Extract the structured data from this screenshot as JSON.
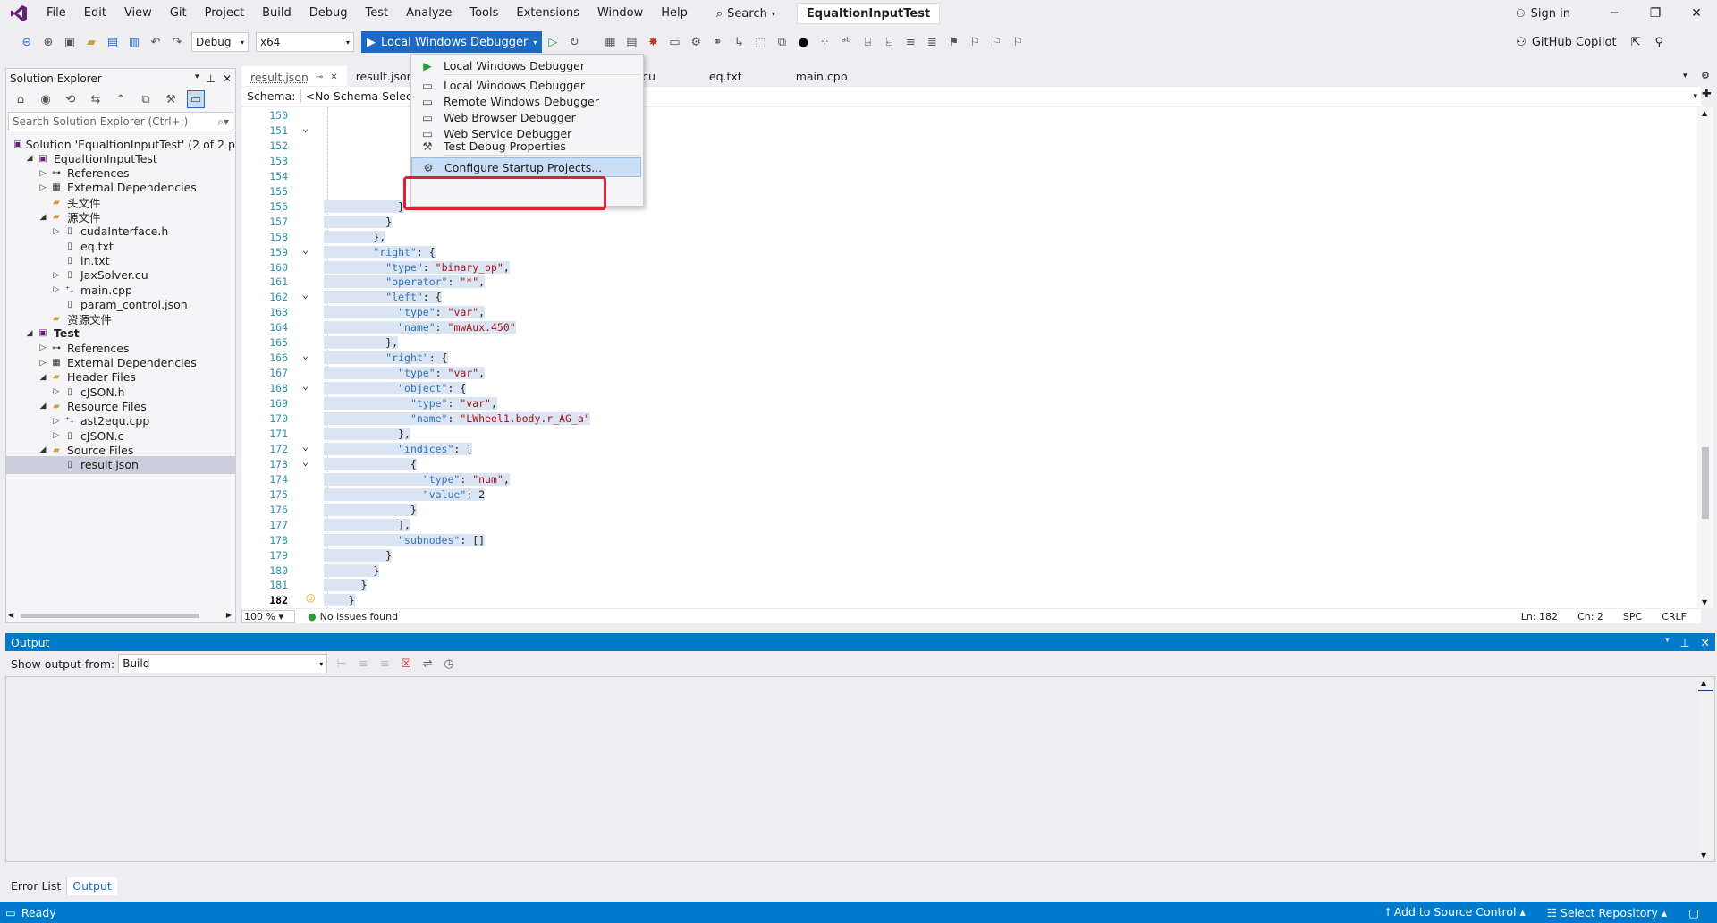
{
  "menu": {
    "items": [
      "File",
      "Edit",
      "View",
      "Git",
      "Project",
      "Build",
      "Debug",
      "Test",
      "Analyze",
      "Tools",
      "Extensions",
      "Window",
      "Help"
    ],
    "search": "Search",
    "title": "EqualtionInputTest",
    "sign_in": "Sign in"
  },
  "toolbar": {
    "config": "Debug",
    "platform": "x64",
    "debugger": "Local Windows Debugger",
    "copilot": "GitHub Copilot"
  },
  "solution_explorer": {
    "title": "Solution Explorer",
    "search_placeholder": "Search Solution Explorer (Ctrl+;)",
    "items": [
      {
        "label": "Solution 'EqualtionInputTest' (2 of 2 p",
        "indent": 0,
        "tw": "",
        "icon": "solution-icon"
      },
      {
        "label": "EqualtionInputTest",
        "indent": 1,
        "tw": "◢",
        "icon": "project-icon"
      },
      {
        "label": "References",
        "indent": 2,
        "tw": "▷",
        "icon": "references-icon"
      },
      {
        "label": "External Dependencies",
        "indent": 2,
        "tw": "▷",
        "icon": "dependencies-icon"
      },
      {
        "label": "头文件",
        "indent": 2,
        "tw": "",
        "icon": "folder-icon"
      },
      {
        "label": "源文件",
        "indent": 2,
        "tw": "◢",
        "icon": "folder-icon"
      },
      {
        "label": "cudaInterface.h",
        "indent": 3,
        "tw": "▷",
        "icon": "file-icon"
      },
      {
        "label": "eq.txt",
        "indent": 3,
        "tw": "",
        "icon": "file-icon"
      },
      {
        "label": "in.txt",
        "indent": 3,
        "tw": "",
        "icon": "file-icon"
      },
      {
        "label": "JaxSolver.cu",
        "indent": 3,
        "tw": "▷",
        "icon": "file-icon"
      },
      {
        "label": "main.cpp",
        "indent": 3,
        "tw": "▷",
        "icon": "cpp-file-icon"
      },
      {
        "label": "param_control.json",
        "indent": 3,
        "tw": "",
        "icon": "file-icon"
      },
      {
        "label": "资源文件",
        "indent": 2,
        "tw": "",
        "icon": "folder-icon"
      },
      {
        "label": "Test",
        "indent": 1,
        "tw": "◢",
        "icon": "project-icon",
        "bold": true
      },
      {
        "label": "References",
        "indent": 2,
        "tw": "▷",
        "icon": "references-icon"
      },
      {
        "label": "External Dependencies",
        "indent": 2,
        "tw": "▷",
        "icon": "dependencies-icon"
      },
      {
        "label": "Header Files",
        "indent": 2,
        "tw": "◢",
        "icon": "folder-icon"
      },
      {
        "label": "cJSON.h",
        "indent": 3,
        "tw": "▷",
        "icon": "file-icon"
      },
      {
        "label": "Resource Files",
        "indent": 2,
        "tw": "◢",
        "icon": "folder-icon"
      },
      {
        "label": "ast2equ.cpp",
        "indent": 3,
        "tw": "▷",
        "icon": "cpp-file-icon"
      },
      {
        "label": "cJSON.c",
        "indent": 3,
        "tw": "▷",
        "icon": "file-icon"
      },
      {
        "label": "Source Files",
        "indent": 2,
        "tw": "◢",
        "icon": "folder-icon"
      },
      {
        "label": "result.json",
        "indent": 3,
        "tw": "",
        "icon": "file-icon",
        "selected": true
      }
    ]
  },
  "tabs": [
    {
      "label": "result.json",
      "active": true
    },
    {
      "label": "result.json",
      "active": false
    },
    {
      "label": "xSolver.cu",
      "active": false
    },
    {
      "label": "eq.txt",
      "active": false
    },
    {
      "label": "main.cpp",
      "active": false
    }
  ],
  "schema": {
    "label": "Schema:",
    "value": "<No Schema Selected"
  },
  "dropdown": {
    "items": [
      {
        "label": "Local Windows Debugger",
        "icon": "play-icon"
      },
      {
        "label": "Local Windows Debugger",
        "icon": "monitor-icon"
      },
      {
        "label": "Remote Windows Debugger",
        "icon": "monitor-icon"
      },
      {
        "label": "Web Browser Debugger",
        "icon": "monitor-icon"
      },
      {
        "label": "Web Service Debugger",
        "icon": "monitor-icon"
      },
      {
        "label": "Test Debug Properties",
        "icon": "wrench-icon"
      },
      {
        "label": "Configure Startup Projects...",
        "icon": "gear-icon",
        "hover": true
      }
    ]
  },
  "code_lines": [
    {
      "n": "150",
      "t": ""
    },
    {
      "n": "151",
      "t": ""
    },
    {
      "n": "152",
      "t": ""
    },
    {
      "n": "153",
      "t": ""
    },
    {
      "n": "154",
      "t": ""
    },
    {
      "n": "155",
      "t": ""
    },
    {
      "n": "156",
      "t": "            }"
    },
    {
      "n": "157",
      "t": "          }"
    },
    {
      "n": "158",
      "t": "        },"
    },
    {
      "n": "159",
      "t": "        \"right\": {"
    },
    {
      "n": "160",
      "t": "          \"type\": \"binary_op\","
    },
    {
      "n": "161",
      "t": "          \"operator\": \"*\","
    },
    {
      "n": "162",
      "t": "          \"left\": {"
    },
    {
      "n": "163",
      "t": "            \"type\": \"var\","
    },
    {
      "n": "164",
      "t": "            \"name\": \"mwAux.450\""
    },
    {
      "n": "165",
      "t": "          },"
    },
    {
      "n": "166",
      "t": "          \"right\": {"
    },
    {
      "n": "167",
      "t": "            \"type\": \"var\","
    },
    {
      "n": "168",
      "t": "            \"object\": {"
    },
    {
      "n": "169",
      "t": "              \"type\": \"var\","
    },
    {
      "n": "170",
      "t": "              \"name\": \"LWheel1.body.r_AG_a\""
    },
    {
      "n": "171",
      "t": "            },"
    },
    {
      "n": "172",
      "t": "            \"indices\": ["
    },
    {
      "n": "173",
      "t": "              {"
    },
    {
      "n": "174",
      "t": "                \"type\": \"num\","
    },
    {
      "n": "175",
      "t": "                \"value\": 2"
    },
    {
      "n": "176",
      "t": "              }"
    },
    {
      "n": "177",
      "t": "            ],"
    },
    {
      "n": "178",
      "t": "            \"subnodes\": []"
    },
    {
      "n": "179",
      "t": "          }"
    },
    {
      "n": "180",
      "t": "        }"
    },
    {
      "n": "181",
      "t": "      }"
    },
    {
      "n": "182",
      "t": "    }"
    }
  ],
  "editor_status": {
    "zoom": "100 %",
    "issues": "No issues found",
    "ln": "Ln: 182",
    "ch": "Ch: 2",
    "spc": "SPC",
    "crlf": "CRLF"
  },
  "output": {
    "title": "Output",
    "show_from_label": "Show output from:",
    "source": "Build"
  },
  "bottom_tabs": [
    "Error List",
    "Output"
  ],
  "statusbar": {
    "ready": "Ready",
    "source_control": "Add to Source Control",
    "repository": "Select Repository"
  }
}
